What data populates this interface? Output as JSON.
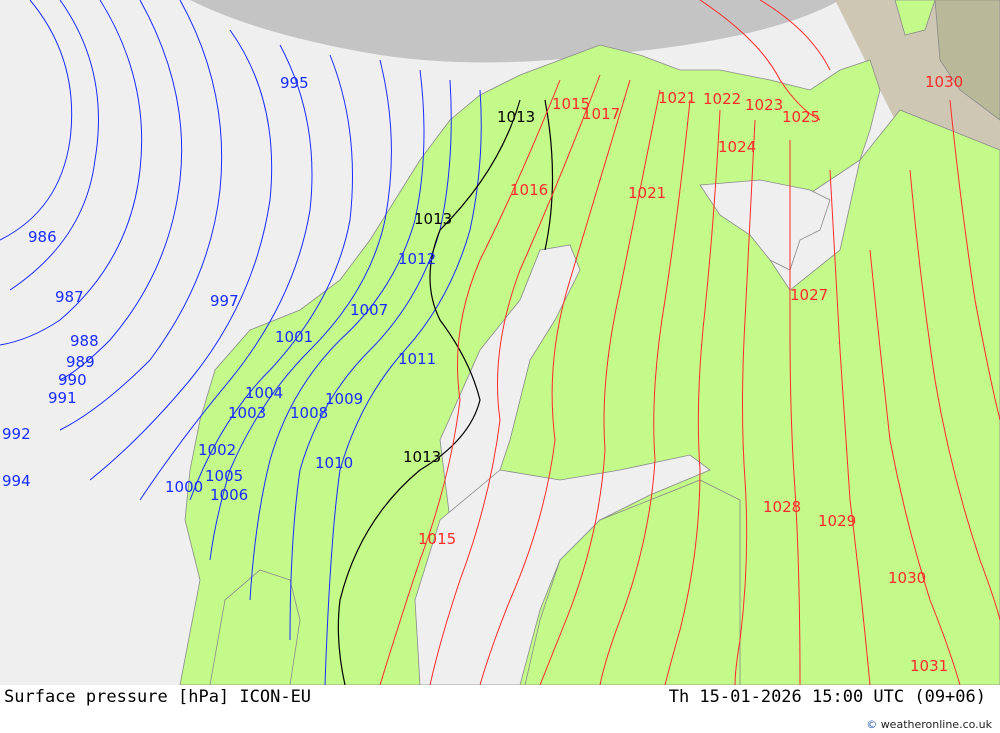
{
  "footer": {
    "title_left": "Surface pressure [hPa] ICON-EU",
    "title_right": "Th 15-01-2026 15:00 UTC (09+06)",
    "credit": "weatheronline.co.uk",
    "credit_icon": "copyright-icon"
  },
  "colors": {
    "sea": "#efefef",
    "land": "#c3fa8a",
    "low_isobar": "#1a2bff",
    "high_isobar": "#ff2a2a",
    "reference_isobar": "#000000",
    "out_of_domain": "#bdbdbd"
  },
  "isobar_labels": {
    "blue": [
      "995",
      "986",
      "987",
      "997",
      "988",
      "989",
      "990",
      "991",
      "992",
      "994",
      "1000",
      "1001",
      "1002",
      "1003",
      "1004",
      "1005",
      "1006",
      "1007",
      "1008",
      "1009",
      "1010",
      "1011",
      "1012"
    ],
    "black": [
      "1013",
      "1013",
      "1013"
    ],
    "red": [
      "1015",
      "1016",
      "1017",
      "1021",
      "1021",
      "1022",
      "1023",
      "1024",
      "1025",
      "1027",
      "1028",
      "1029",
      "1030",
      "1030",
      "1031",
      "1015"
    ]
  }
}
